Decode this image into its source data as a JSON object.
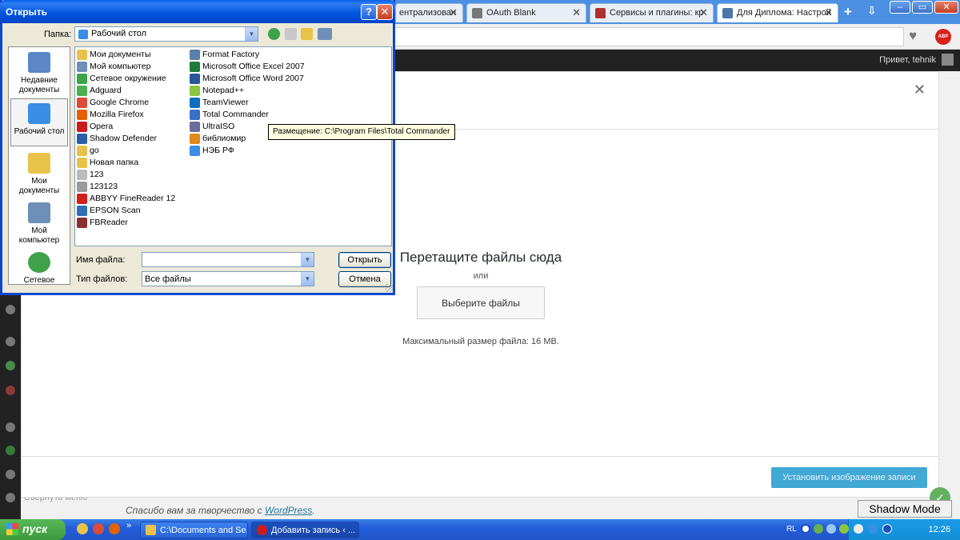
{
  "browser": {
    "tabs": [
      {
        "label": "ентрализован",
        "icon_color": "#e05a00"
      },
      {
        "label": "OAuth Blank",
        "icon_color": "#777777"
      },
      {
        "label": "Сервисы и плагины: кр",
        "icon_color": "#b03030"
      },
      {
        "label": "Для Диплома: Настрой",
        "icon_color": "#4a76a8"
      }
    ],
    "new_tab": "+",
    "tab_menu": "⇩",
    "window_buttons": [
      "–",
      "▭",
      "✕"
    ],
    "heart_icon": "♥",
    "adblock_badge": "ABP",
    "greeting": "Привет, tehnik"
  },
  "sidebar": {
    "collapse_label": "Свернуть меню"
  },
  "footer": {
    "thanks_prefix": "Спасибо вам за творчество с ",
    "thanks_link": "WordPress",
    "thanks_suffix": "."
  },
  "media_modal": {
    "close": "✕",
    "drop_title": "Перетащите файлы сюда",
    "or": "или",
    "select_files": "Выберите файлы",
    "max_size": "Максимальный размер файла: 16 MB.",
    "set_featured": "Установить изображение записи"
  },
  "dialog": {
    "title": "Открыть",
    "help": "?",
    "close": "✕",
    "folder_label": "Папка:",
    "folder_value": "Рабочий стол",
    "places": [
      {
        "label": "Недавние документы",
        "color": "#5b87c9"
      },
      {
        "label": "Рабочий стол",
        "color": "#3a8ee6",
        "active": true
      },
      {
        "label": "Мои документы",
        "color": "#e9c24a"
      },
      {
        "label": "Мой компьютер",
        "color": "#6d8fb8"
      },
      {
        "label": "Сетевое",
        "color": "#3fa24a"
      }
    ],
    "files_col1": [
      {
        "name": "Мои документы",
        "color": "#e9c24a"
      },
      {
        "name": "Мой компьютер",
        "color": "#6d8fb8"
      },
      {
        "name": "Сетевое окружение",
        "color": "#3fa24a"
      },
      {
        "name": "Adguard",
        "color": "#4caf50"
      },
      {
        "name": "Google Chrome",
        "color": "#dd4b39"
      },
      {
        "name": "Mozilla Firefox",
        "color": "#e66000"
      },
      {
        "name": "Opera",
        "color": "#cc1b1b"
      },
      {
        "name": "Shadow Defender",
        "color": "#2b5fa8"
      },
      {
        "name": "go",
        "color": "#e9c24a"
      },
      {
        "name": "Новая папка",
        "color": "#e9c24a"
      },
      {
        "name": "123",
        "color": "#bbbbbb"
      },
      {
        "name": "123123",
        "color": "#9a9a9a"
      },
      {
        "name": "ABBYY FineReader 12",
        "color": "#d0201a"
      },
      {
        "name": "EPSON Scan",
        "color": "#2f6fb8"
      },
      {
        "name": "FBReader",
        "color": "#8a2f2f"
      }
    ],
    "files_col2": [
      {
        "name": "Format Factory",
        "color": "#5a7fa8"
      },
      {
        "name": "Microsoft Office Excel 2007",
        "color": "#1d7a3a"
      },
      {
        "name": "Microsoft Office Word 2007",
        "color": "#2b579a"
      },
      {
        "name": "Notepad++",
        "color": "#8cc63f"
      },
      {
        "name": "TeamViewer",
        "color": "#0e6fc1"
      },
      {
        "name": "Total Commander",
        "color": "#3a6fc7"
      },
      {
        "name": "UltraISO",
        "color": "#6c6c9a"
      },
      {
        "name": "библиомир",
        "color": "#e08a1e"
      },
      {
        "name": "НЭБ РФ",
        "color": "#3a8ee6"
      }
    ],
    "tooltip": "Размещение: C:\\Program Files\\Total Commander",
    "filename_label": "Имя файла:",
    "filename_value": "",
    "filetype_label": "Тип файлов:",
    "filetype_value": "Все файлы",
    "open_button": "Открыть",
    "cancel_button": "Отмена"
  },
  "taskbar": {
    "start": "пуск",
    "overflow": "»",
    "buttons": [
      {
        "label": "C:\\Documents and Se...",
        "color": "#e9c24a"
      },
      {
        "label": "Добавить запись ‹ ...",
        "color": "#cc1b1b"
      }
    ],
    "lang": "RL",
    "clock": "12:26"
  },
  "overlay": {
    "shadow_mode": "Shadow Mode",
    "check": "✓"
  }
}
